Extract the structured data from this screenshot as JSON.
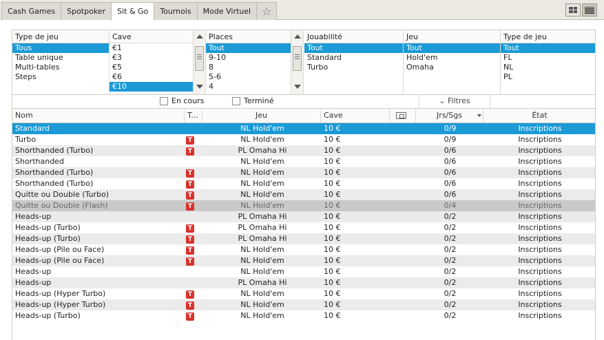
{
  "tabs": [
    "Cash Games",
    "Spotpoker",
    "Sit & Go",
    "Tournois",
    "Mode Virtuel"
  ],
  "star_icon": "☆",
  "filters": {
    "type_de_jeu": {
      "header": "Type de jeu",
      "items": [
        "Tous",
        "Table unique",
        "Multi-tables",
        "Steps"
      ]
    },
    "cave": {
      "header": "Cave",
      "items": [
        "€1",
        "€3",
        "€5",
        "€6",
        "€10"
      ]
    },
    "places": {
      "header": "Places",
      "items": [
        "Tout",
        "9-10",
        "8",
        "5-6",
        "4"
      ]
    },
    "jouabilite": {
      "header": "Jouabilité",
      "items": [
        "Tout",
        "Standard",
        "Turbo"
      ]
    },
    "jeu": {
      "header": "Jeu",
      "items": [
        "Tout",
        "Hold'em",
        "Omaha"
      ]
    },
    "type_de_jeu_2": {
      "header": "Type de jeu",
      "items": [
        "Tout",
        "FL",
        "NL",
        "PL"
      ]
    }
  },
  "toolbar": {
    "en_cours": "En cours",
    "termine": "Terminé",
    "filtres": "Filtres",
    "filtres_arrow": "⌄"
  },
  "columns": {
    "nom": "Nom",
    "t": "T...",
    "jeu": "Jeu",
    "cave": "Cave",
    "jrs": "Jrs/Sgs",
    "etat": "État"
  },
  "rows": [
    {
      "nom": "Standard",
      "t": "",
      "jeu": "NL Hold'em",
      "cave": "10 €",
      "jrs": "0/9",
      "etat": "Inscriptions"
    },
    {
      "nom": "Turbo",
      "t": "T",
      "jeu": "NL Hold'em",
      "cave": "10 €",
      "jrs": "0/9",
      "etat": "Inscriptions"
    },
    {
      "nom": "Shorthanded (Turbo)",
      "t": "T",
      "jeu": "PL Omaha Hi",
      "cave": "10 €",
      "jrs": "0/6",
      "etat": "Inscriptions"
    },
    {
      "nom": "Shorthanded",
      "t": "",
      "jeu": "NL Hold'em",
      "cave": "10 €",
      "jrs": "0/6",
      "etat": "Inscriptions"
    },
    {
      "nom": "Shorthanded (Turbo)",
      "t": "T",
      "jeu": "NL Hold'em",
      "cave": "10 €",
      "jrs": "0/6",
      "etat": "Inscriptions"
    },
    {
      "nom": "Shorthanded (Turbo)",
      "t": "T",
      "jeu": "NL Hold'em",
      "cave": "10 €",
      "jrs": "0/6",
      "etat": "Inscriptions"
    },
    {
      "nom": "Quitte ou Double (Turbo)",
      "t": "T",
      "jeu": "NL Hold'em",
      "cave": "10 €",
      "jrs": "0/6",
      "etat": "Inscriptions"
    },
    {
      "nom": "Quitte ou Double (Flash)",
      "t": "T",
      "jeu": "NL Hold'em",
      "cave": "10 €",
      "jrs": "0/4",
      "etat": "Inscriptions"
    },
    {
      "nom": "Heads-up",
      "t": "",
      "jeu": "PL Omaha Hi",
      "cave": "10 €",
      "jrs": "0/2",
      "etat": "Inscriptions"
    },
    {
      "nom": "Heads-up (Turbo)",
      "t": "T",
      "jeu": "PL Omaha Hi",
      "cave": "10 €",
      "jrs": "0/2",
      "etat": "Inscriptions"
    },
    {
      "nom": "Heads-up (Turbo)",
      "t": "T",
      "jeu": "PL Omaha Hi",
      "cave": "10 €",
      "jrs": "0/2",
      "etat": "Inscriptions"
    },
    {
      "nom": "Heads-up (Pile ou Face)",
      "t": "T",
      "jeu": "NL Hold'em",
      "cave": "10 €",
      "jrs": "0/2",
      "etat": "Inscriptions"
    },
    {
      "nom": "Heads-up (Pile ou Face)",
      "t": "T",
      "jeu": "NL Hold'em",
      "cave": "10 €",
      "jrs": "0/2",
      "etat": "Inscriptions"
    },
    {
      "nom": "Heads-up",
      "t": "",
      "jeu": "NL Hold'em",
      "cave": "10 €",
      "jrs": "0/2",
      "etat": "Inscriptions"
    },
    {
      "nom": "Heads-up",
      "t": "",
      "jeu": "PL Omaha Hi",
      "cave": "10 €",
      "jrs": "0/2",
      "etat": "Inscriptions"
    },
    {
      "nom": "Heads-up (Hyper Turbo)",
      "t": "T",
      "jeu": "NL Hold'em",
      "cave": "10 €",
      "jrs": "0/2",
      "etat": "Inscriptions"
    },
    {
      "nom": "Heads-up (Hyper Turbo)",
      "t": "T",
      "jeu": "NL Hold'em",
      "cave": "10 €",
      "jrs": "0/2",
      "etat": "Inscriptions"
    },
    {
      "nom": "Heads-up (Turbo)",
      "t": "T",
      "jeu": "NL Hold'em",
      "cave": "10 €",
      "jrs": "0/2",
      "etat": "Inscriptions"
    }
  ],
  "colors": {
    "selection": "#1b9ad6",
    "badge": "#d8322e",
    "alt_row": "#ebebeb",
    "grey_row": "#c9c9c9"
  }
}
